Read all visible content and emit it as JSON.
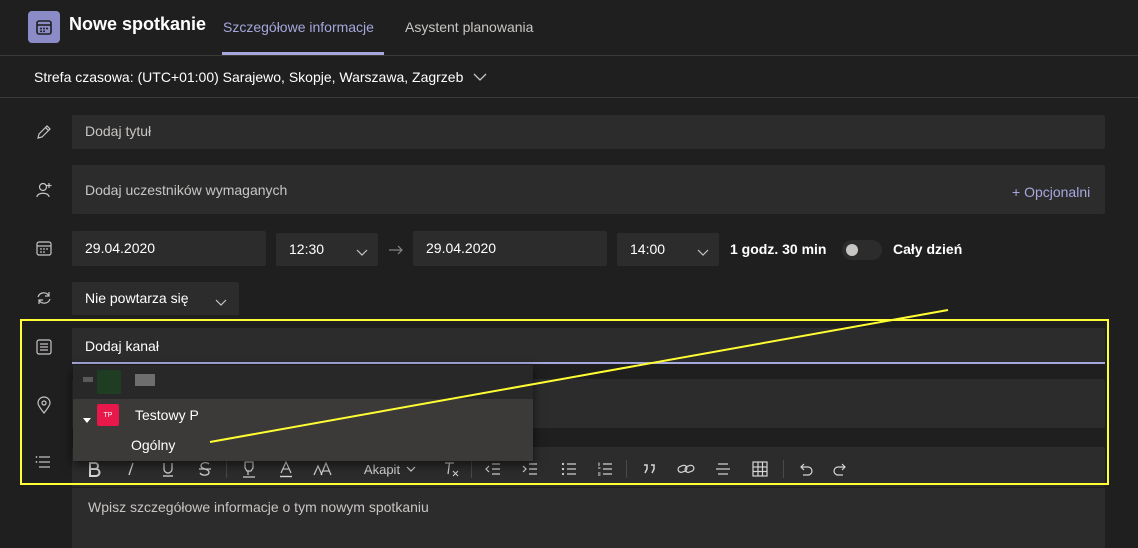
{
  "header": {
    "title": "Nowe spotkanie",
    "tabs": [
      {
        "label": "Szczegółowe informacje",
        "active": true
      },
      {
        "label": "Asystent planowania",
        "active": false
      }
    ]
  },
  "timezone": {
    "label": "Strefa czasowa: (UTC+01:00) Sarajewo, Skopje, Warszawa, Zagrzeb"
  },
  "form": {
    "title_placeholder": "Dodaj tytuł",
    "attendees_placeholder": "Dodaj uczestników wymaganych",
    "optional_link": "+ Opcjonalni",
    "start_date": "29.04.2020",
    "start_time": "12:30",
    "end_date": "29.04.2020",
    "end_time": "14:00",
    "duration": "1 godz. 30 min",
    "all_day_label": "Cały dzień",
    "all_day": false,
    "repeat": "Nie powtarza się",
    "channel_placeholder": "Dodaj kanał",
    "details_placeholder": "Wpisz szczegółowe informacje o tym nowym spotkaniu"
  },
  "channel_dropdown": {
    "teams": [
      {
        "name": "Testowy P",
        "avatar_initials": "TP",
        "expanded": true,
        "channels": [
          "Ogólny"
        ]
      }
    ]
  },
  "toolbar": {
    "paragraph_label": "Akapit"
  },
  "colors": {
    "accent": "#a6a7dc",
    "highlight": "#ffff33",
    "team_avatar": "#e8184a"
  }
}
